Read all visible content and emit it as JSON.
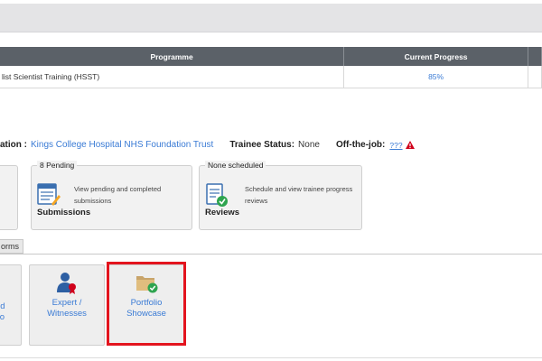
{
  "table": {
    "headers": [
      "Programme",
      "Current Progress",
      ""
    ],
    "rows": [
      {
        "programme": "list Scientist Training (HSST)",
        "progress": "85%"
      }
    ]
  },
  "info": {
    "location_label": "ation :",
    "location_value": "Kings College Hospital NHS Foundation Trust",
    "status_label": "Trainee Status:",
    "status_value": "None",
    "otj_label": "Off-the-job:",
    "otj_value": "???"
  },
  "cards": [
    {
      "legend": "8 Pending",
      "desc_line1": "View pending and completed",
      "desc_line2": "submissions",
      "title": "Submissions"
    },
    {
      "legend": "None scheduled",
      "desc_line1": "Schedule and view trainee progress",
      "desc_line2": "reviews",
      "title": "Reviews"
    }
  ],
  "tab_label": "orms",
  "tiles": [
    {
      "line1": "nd",
      "line2": "o"
    },
    {
      "line1": "Expert /",
      "line2": "Witnesses"
    },
    {
      "line1": "Portfolio",
      "line2": "Showcase"
    }
  ],
  "colors": {
    "accent": "#3a7bd5",
    "highlight": "#e3141e",
    "warning": "#d0021b",
    "header_bg": "#5b6168"
  }
}
